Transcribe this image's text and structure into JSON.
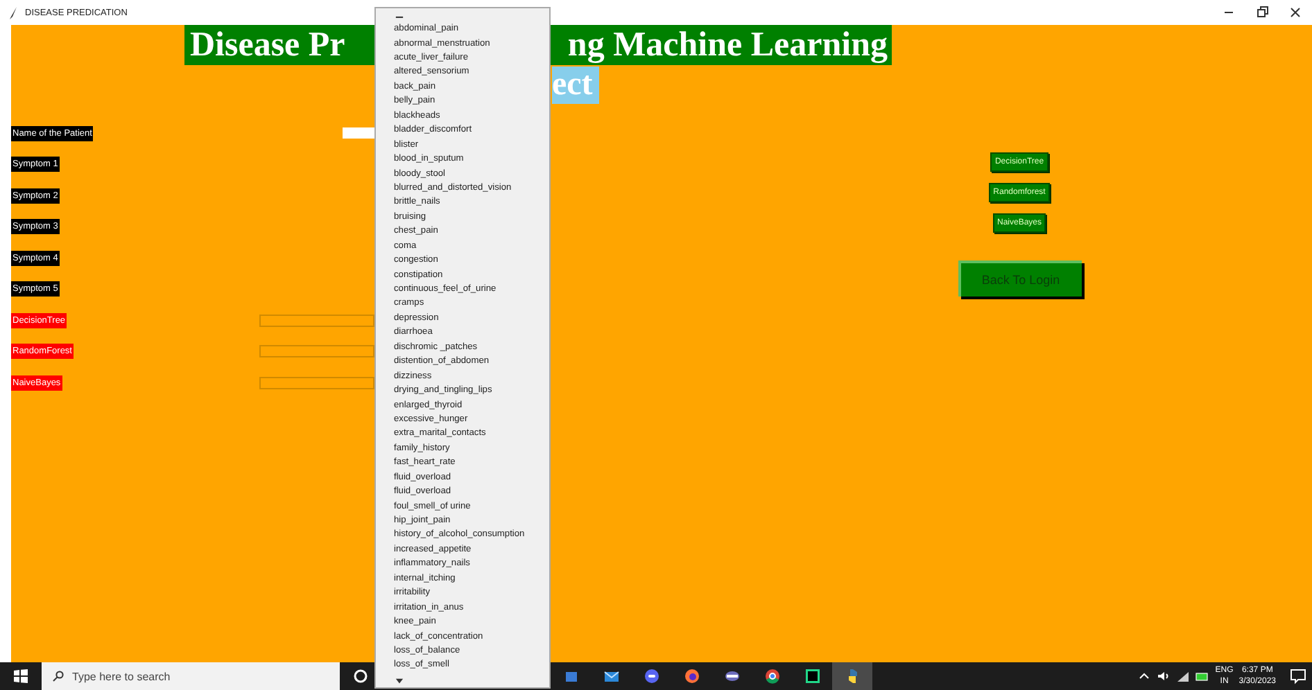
{
  "window": {
    "title": "DISEASE PREDICATION"
  },
  "heading": {
    "parts": [
      "Disease Pr",
      "ng Machine Learning"
    ]
  },
  "subheading": "ect",
  "form": {
    "name_label": "Name of the Patient",
    "symptoms": [
      "Symptom 1",
      "Symptom 2",
      "Symptom 3",
      "Symptom 4",
      "Symptom 5"
    ],
    "results": [
      "DecisionTree",
      "RandomForest",
      "NaiveBayes"
    ]
  },
  "buttons": [
    "DecisionTree",
    "Randomforest",
    "NaiveBayes"
  ],
  "back_button": "Back To Login",
  "dropdown": {
    "items": [
      "abdominal_pain",
      "abnormal_menstruation",
      "acute_liver_failure",
      "altered_sensorium",
      "back_pain",
      "belly_pain",
      "blackheads",
      "bladder_discomfort",
      "blister",
      "blood_in_sputum",
      "bloody_stool",
      "blurred_and_distorted_vision",
      "brittle_nails",
      "bruising",
      "chest_pain",
      "coma",
      "congestion",
      "constipation",
      "continuous_feel_of_urine",
      "cramps",
      "depression",
      "diarrhoea",
      "dischromic _patches",
      "distention_of_abdomen",
      "dizziness",
      "drying_and_tingling_lips",
      "enlarged_thyroid",
      "excessive_hunger",
      "extra_marital_contacts",
      "family_history",
      "fast_heart_rate",
      "fluid_overload",
      "fluid_overload",
      "foul_smell_of urine",
      "hip_joint_pain",
      "history_of_alcohol_consumption",
      "increased_appetite",
      "inflammatory_nails",
      "internal_itching",
      "irritability",
      "irritation_in_anus",
      "knee_pain",
      "lack_of_concentration",
      "loss_of_balance",
      "loss_of_smell"
    ]
  },
  "taskbar": {
    "search": {
      "placeholder": "Type here to search"
    },
    "language": "ENG",
    "region": "IN",
    "time": "6:37 PM",
    "date": "3/30/2023"
  }
}
